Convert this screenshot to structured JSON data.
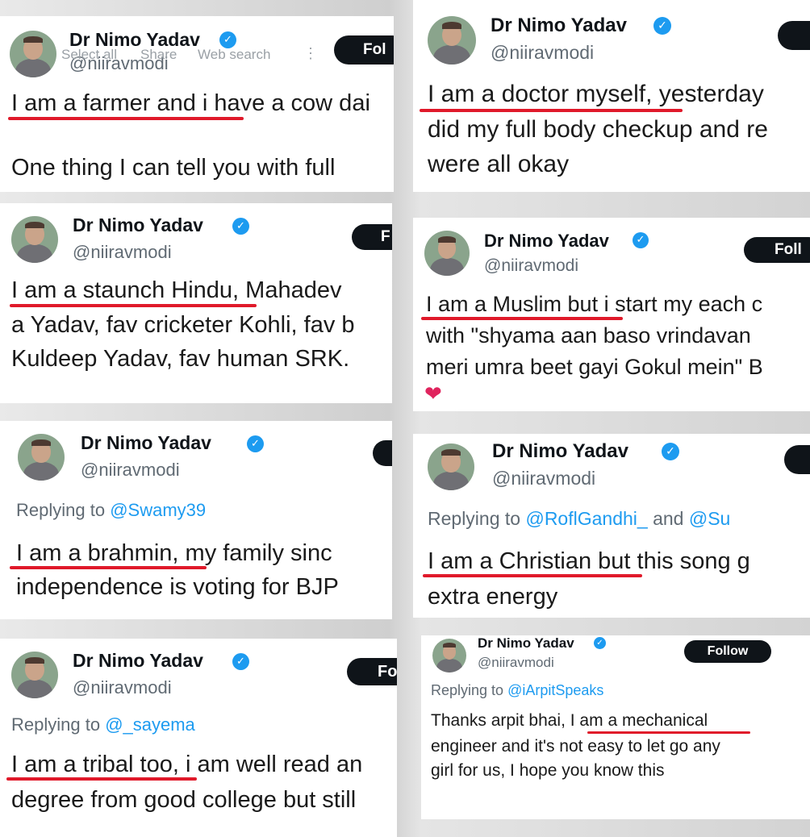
{
  "context_menu": {
    "items": [
      "Select all",
      "Share",
      "Web search"
    ],
    "more_icon": "more-vertical-icon"
  },
  "tweets": [
    {
      "name": "Dr Nimo Yadav",
      "handle": "@niiravmodi",
      "follow_label": "Fol",
      "line1_highlight": "I am a farmer and i have a cow dai",
      "line2": "One thing I can tell you with full"
    },
    {
      "name": "Dr Nimo Yadav",
      "handle": "@niiravmodi",
      "follow_label": "",
      "line1_highlight": "I am a doctor myself",
      "line1_rest": ", yesterday",
      "line2": "did my full body checkup and re",
      "line3": "were all okay"
    },
    {
      "name": "Dr Nimo Yadav",
      "handle": "@niiravmodi",
      "follow_label": "F",
      "line1_highlight": "I am a staunch Hindu",
      "line1_rest": ", Mahadev",
      "line2": "a Yadav, fav cricketer Kohli, fav b",
      "line3": "Kuldeep Yadav, fav human SRK."
    },
    {
      "name": "Dr Nimo Yadav",
      "handle": "@niiravmodi",
      "follow_label": "Foll",
      "line1_highlight": "I am a Muslim",
      "line1_rest": " but i start my each c",
      "line2": "with \"shyama aan baso vrindavan",
      "line3": "meri umra beet gayi Gokul mein\" B",
      "heart": "❤"
    },
    {
      "name": "Dr Nimo Yadav",
      "handle": "@niiravmodi",
      "reply_prefix": "Replying to ",
      "reply_mention": "@Swamy39",
      "line1_highlight": "I am a brahmin",
      "line1_rest": ", my family sinc",
      "line2": "independence is voting for BJP"
    },
    {
      "name": "Dr Nimo Yadav",
      "handle": "@niiravmodi",
      "reply_prefix": "Replying to ",
      "reply_mention": "@RoflGandhi_",
      "reply_and": " and ",
      "reply_mention2": "@Su",
      "line1_highlight": "I am a Christian",
      "line1_rest": " but this song g",
      "line2": "extra energy"
    },
    {
      "name": "Dr Nimo Yadav",
      "handle": "@niiravmodi",
      "follow_label": "Fo",
      "reply_prefix": "Replying to ",
      "reply_mention": "@_sayema",
      "line1_highlight": "I am a tribal too",
      "line1_rest": ", i am well read an",
      "line2": "degree from good college but still"
    },
    {
      "name": "Dr Nimo Yadav",
      "handle": "@niiravmodi",
      "follow_label": "Follow",
      "reply_prefix": "Replying to ",
      "reply_mention": "@iArpitSpeaks",
      "line1_prefix": "Thanks arpit bhai, ",
      "line1_highlight": "I am a mechanical",
      "line2": "engineer and it's not easy to let go any",
      "line3": "girl  for us, I hope you know this"
    }
  ],
  "colors": {
    "verified": "#1d9bf0",
    "mention": "#1d9bf0",
    "underline": "#e0192a",
    "follow_bg": "#0f1419"
  }
}
